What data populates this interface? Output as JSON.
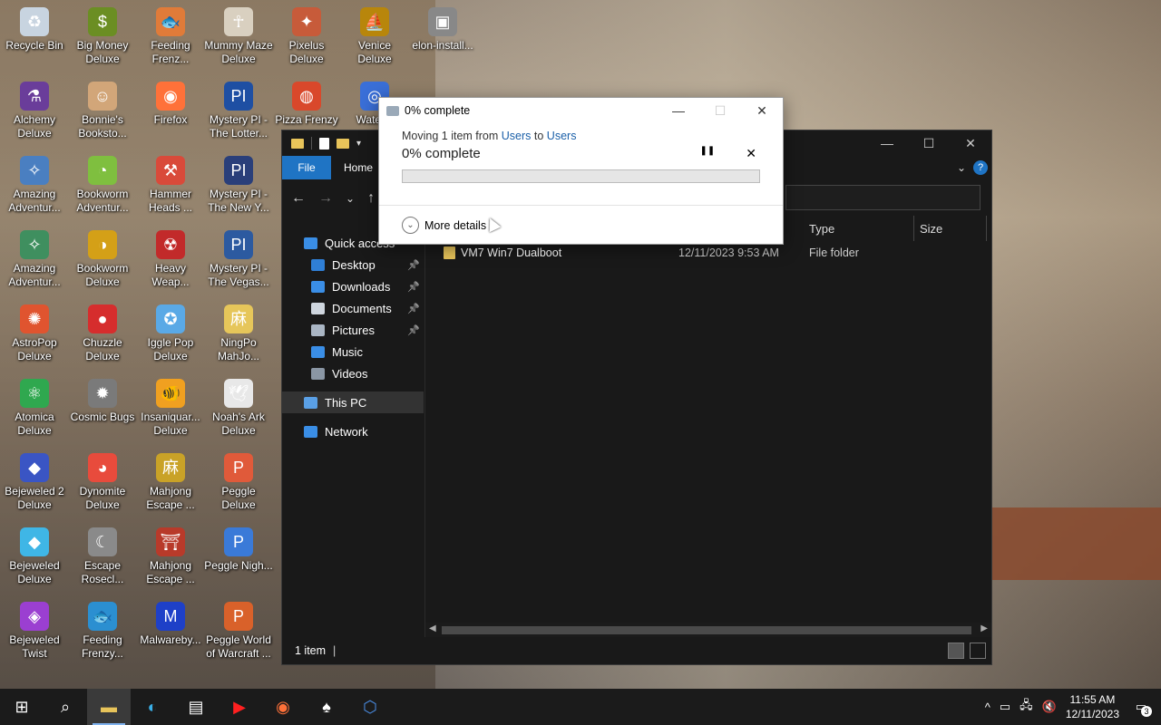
{
  "desktop": {
    "icons": [
      {
        "label": "Recycle Bin",
        "icon": "recycle-bin-icon",
        "color": "#c8d4e0",
        "glyph": "♻"
      },
      {
        "label": "Big Money Deluxe",
        "icon": "big-money-icon",
        "color": "#6b8e23",
        "glyph": "$"
      },
      {
        "label": "Feeding Frenz...",
        "icon": "feeding-frenzy-icon",
        "color": "#e07b39",
        "glyph": "🐟"
      },
      {
        "label": "Mummy Maze Deluxe",
        "icon": "mummy-maze-icon",
        "color": "#d9d0c0",
        "glyph": "☥"
      },
      {
        "label": "Pixelus Deluxe",
        "icon": "pixelus-icon",
        "color": "#c75b3a",
        "glyph": "✦"
      },
      {
        "label": "Venice Deluxe",
        "icon": "venice-icon",
        "color": "#b8860b",
        "glyph": "⛵"
      },
      {
        "label": "elon-install...",
        "icon": "installer-icon",
        "color": "#888888",
        "glyph": "▣"
      },
      {
        "label": "Alchemy Deluxe",
        "icon": "alchemy-icon",
        "color": "#6a3d9a",
        "glyph": "⚗"
      },
      {
        "label": "Bonnie's Booksto...",
        "icon": "bonnies-bookstore-icon",
        "color": "#d2a679",
        "glyph": "☺"
      },
      {
        "label": "Firefox",
        "icon": "firefox-icon",
        "color": "#ff7139",
        "glyph": "◉"
      },
      {
        "label": "Mystery PI - The Lotter...",
        "icon": "mystery-pi-icon",
        "color": "#1e4fa3",
        "glyph": "PI"
      },
      {
        "label": "Pizza Frenzy",
        "icon": "pizza-frenzy-icon",
        "color": "#d9482b",
        "glyph": "◍"
      },
      {
        "label": "Water...",
        "icon": "water-icon",
        "color": "#3a6fd8",
        "glyph": "◎"
      },
      {
        "label": "Amazing Adventur...",
        "icon": "amazing-adventures-icon",
        "color": "#4a7fc1",
        "glyph": "✧"
      },
      {
        "label": "Bookworm Adventur...",
        "icon": "bookworm-adventures-icon",
        "color": "#7fbf3f",
        "glyph": "◔"
      },
      {
        "label": "Hammer Heads ...",
        "icon": "hammer-heads-icon",
        "color": "#d94a3a",
        "glyph": "⚒"
      },
      {
        "label": "Mystery PI - The New Y...",
        "icon": "mystery-pi-ny-icon",
        "color": "#2a3f7a",
        "glyph": "PI"
      },
      {
        "label": "Amazing Adventur...",
        "icon": "amazing-adventures-2-icon",
        "color": "#3f8f5f",
        "glyph": "✧"
      },
      {
        "label": "Bookworm Deluxe",
        "icon": "bookworm-deluxe-icon",
        "color": "#d4a017",
        "glyph": "◑"
      },
      {
        "label": "Heavy Weap...",
        "icon": "heavy-weapon-icon",
        "color": "#c22a2a",
        "glyph": "☢"
      },
      {
        "label": "Mystery PI - The Vegas...",
        "icon": "mystery-pi-vegas-icon",
        "color": "#2c5aa0",
        "glyph": "PI"
      },
      {
        "label": "AstroPop Deluxe",
        "icon": "astropop-icon",
        "color": "#e0542f",
        "glyph": "✺"
      },
      {
        "label": "Chuzzle Deluxe",
        "icon": "chuzzle-icon",
        "color": "#d62d2d",
        "glyph": "●"
      },
      {
        "label": "Iggle Pop Deluxe",
        "icon": "iggle-pop-icon",
        "color": "#5aa9e6",
        "glyph": "✪"
      },
      {
        "label": "NingPo MahJo...",
        "icon": "ningpo-mahjong-icon",
        "color": "#e6c65a",
        "glyph": "麻"
      },
      {
        "label": "Atomica Deluxe",
        "icon": "atomica-icon",
        "color": "#2fa84f",
        "glyph": "⚛"
      },
      {
        "label": "Cosmic Bugs",
        "icon": "cosmic-bugs-icon",
        "color": "#7a7a7a",
        "glyph": "✹"
      },
      {
        "label": "Insaniquar... Deluxe",
        "icon": "insaniquarium-icon",
        "color": "#f0a020",
        "glyph": "🐠"
      },
      {
        "label": "Noah's Ark Deluxe",
        "icon": "noahs-ark-icon",
        "color": "#e8e8e8",
        "glyph": "🕊"
      },
      {
        "label": "Bejeweled 2 Deluxe",
        "icon": "bejeweled-2-icon",
        "color": "#3a55c4",
        "glyph": "◆"
      },
      {
        "label": "Dynomite Deluxe",
        "icon": "dynomite-icon",
        "color": "#e84b3c",
        "glyph": "◕"
      },
      {
        "label": "Mahjong Escape ...",
        "icon": "mahjong-escape-icon",
        "color": "#c9a227",
        "glyph": "麻"
      },
      {
        "label": "Peggle Deluxe",
        "icon": "peggle-deluxe-icon",
        "color": "#e05a3a",
        "glyph": "P"
      },
      {
        "label": "Bejeweled Deluxe",
        "icon": "bejeweled-deluxe-icon",
        "color": "#3fb6e6",
        "glyph": "◆"
      },
      {
        "label": "Escape Rosecl...",
        "icon": "escape-rosecliff-icon",
        "color": "#8a8a8a",
        "glyph": "☾"
      },
      {
        "label": "Mahjong Escape ...",
        "icon": "mahjong-escape-2-icon",
        "color": "#b83a2a",
        "glyph": "⛩"
      },
      {
        "label": "Peggle Nigh...",
        "icon": "peggle-nights-icon",
        "color": "#3a7ad8",
        "glyph": "P"
      },
      {
        "label": "Bejeweled Twist",
        "icon": "bejeweled-twist-icon",
        "color": "#9b3fd1",
        "glyph": "◈"
      },
      {
        "label": "Feeding Frenzy...",
        "icon": "feeding-frenzy-2-icon",
        "color": "#2b8fd1",
        "glyph": "🐟"
      },
      {
        "label": "Malwareby...",
        "icon": "malwarebytes-icon",
        "color": "#1e40c8",
        "glyph": "M"
      },
      {
        "label": "Peggle World of Warcraft ...",
        "icon": "peggle-wow-icon",
        "color": "#d9612a",
        "glyph": "P"
      }
    ]
  },
  "explorer": {
    "tabs": {
      "file": "File",
      "home": "Home"
    },
    "nav": {
      "back": "←",
      "forward": "→",
      "recent": "⌄",
      "up": "↑"
    },
    "window_controls": {
      "minimize": "—",
      "maximize": "☐",
      "close": "✕"
    },
    "sidebar": [
      {
        "label": "Quick access",
        "icon": "star-icon",
        "color": "#3a8ee6",
        "pinned": false
      },
      {
        "label": "Desktop",
        "icon": "desktop-folder-icon",
        "color": "#2f7fd6",
        "pinned": true
      },
      {
        "label": "Downloads",
        "icon": "downloads-folder-icon",
        "color": "#3a8ee6",
        "pinned": true
      },
      {
        "label": "Documents",
        "icon": "documents-folder-icon",
        "color": "#cfd6de",
        "pinned": true
      },
      {
        "label": "Pictures",
        "icon": "pictures-folder-icon",
        "color": "#aab6c4",
        "pinned": true
      },
      {
        "label": "Music",
        "icon": "music-folder-icon",
        "color": "#3a8ee6",
        "pinned": false
      },
      {
        "label": "Videos",
        "icon": "videos-folder-icon",
        "color": "#8a96a4",
        "pinned": false
      },
      {
        "label": "This PC",
        "icon": "this-pc-icon",
        "color": "#5aa0e6",
        "pinned": false
      },
      {
        "label": "Network",
        "icon": "network-icon",
        "color": "#3a8ee6",
        "pinned": false
      }
    ],
    "pin_glyph": "📌",
    "columns": {
      "type": "Type",
      "size": "Size"
    },
    "rows": [
      {
        "name": "VM7 Win7 Dualboot",
        "date": "12/11/2023 9:53 AM",
        "type": "File folder"
      }
    ],
    "status": "1 item"
  },
  "dialog": {
    "title": "0% complete",
    "moving_prefix": "Moving 1 item from ",
    "from": "Users",
    "to_word": " to ",
    "to": "Users",
    "percent_label": "0% complete",
    "progress": 0,
    "pause": "❚❚",
    "cancel": "✕",
    "more_details": "More details",
    "controls": {
      "minimize": "—",
      "maximize": "☐",
      "close": "✕"
    }
  },
  "taskbar": {
    "apps": [
      {
        "name": "start",
        "icon": "windows-start-icon",
        "glyph": "⊞"
      },
      {
        "name": "search",
        "icon": "search-icon",
        "glyph": "⌕"
      },
      {
        "name": "file-explorer",
        "icon": "file-explorer-icon",
        "glyph": "▬",
        "active": true
      },
      {
        "name": "edge",
        "icon": "edge-icon",
        "glyph": "◐"
      },
      {
        "name": "store",
        "icon": "store-icon",
        "glyph": "▤"
      },
      {
        "name": "youtube",
        "icon": "youtube-icon",
        "glyph": "▶"
      },
      {
        "name": "firefox",
        "icon": "firefox-taskbar-icon",
        "glyph": "◉"
      },
      {
        "name": "solitaire",
        "icon": "solitaire-icon",
        "glyph": "♠"
      },
      {
        "name": "app",
        "icon": "app-icon",
        "glyph": "⬡"
      }
    ],
    "tray": {
      "chevron": "^",
      "time": "11:55 AM",
      "date": "12/11/2023",
      "notifications": "3"
    }
  }
}
